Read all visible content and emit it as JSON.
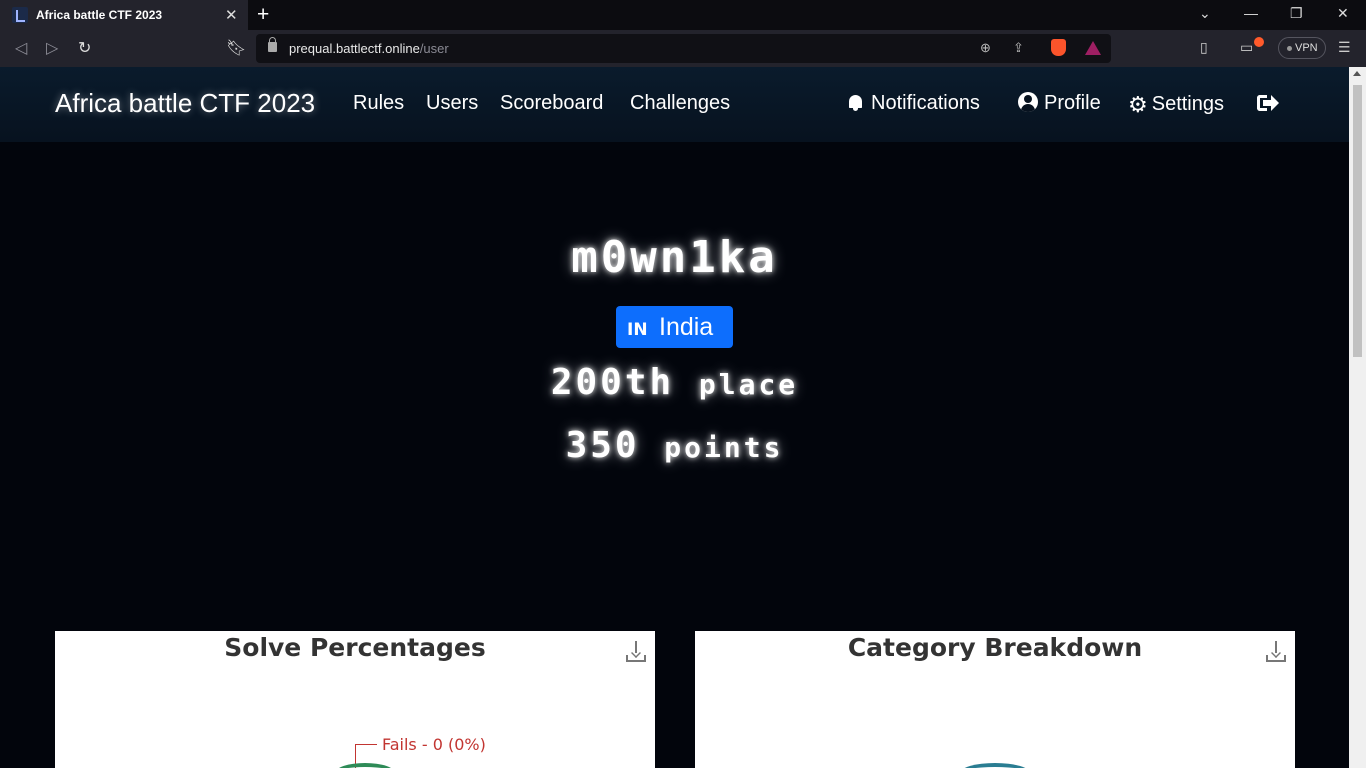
{
  "browser": {
    "tab_title": "Africa battle CTF 2023",
    "url_host": "prequal.battlectf.online",
    "url_path": "/user",
    "vpn_label": "VPN"
  },
  "nav": {
    "brand": "Africa battle CTF 2023",
    "links": [
      "Rules",
      "Users",
      "Scoreboard",
      "Challenges"
    ],
    "notifications": "Notifications",
    "profile": "Profile",
    "settings": "Settings"
  },
  "user": {
    "name": "m0wn1ka",
    "country_code": "IN",
    "country": "India",
    "place_value": "200th",
    "place_label": "place",
    "points_value": "350",
    "points_label": "points"
  },
  "charts": {
    "solve_title": "Solve Percentages",
    "category_title": "Category Breakdown",
    "fails_label": "Fails - 0 (0%)"
  },
  "colors": {
    "accent": "#0d6efd",
    "fails": "#c23531",
    "page_bg": "#02050c"
  }
}
